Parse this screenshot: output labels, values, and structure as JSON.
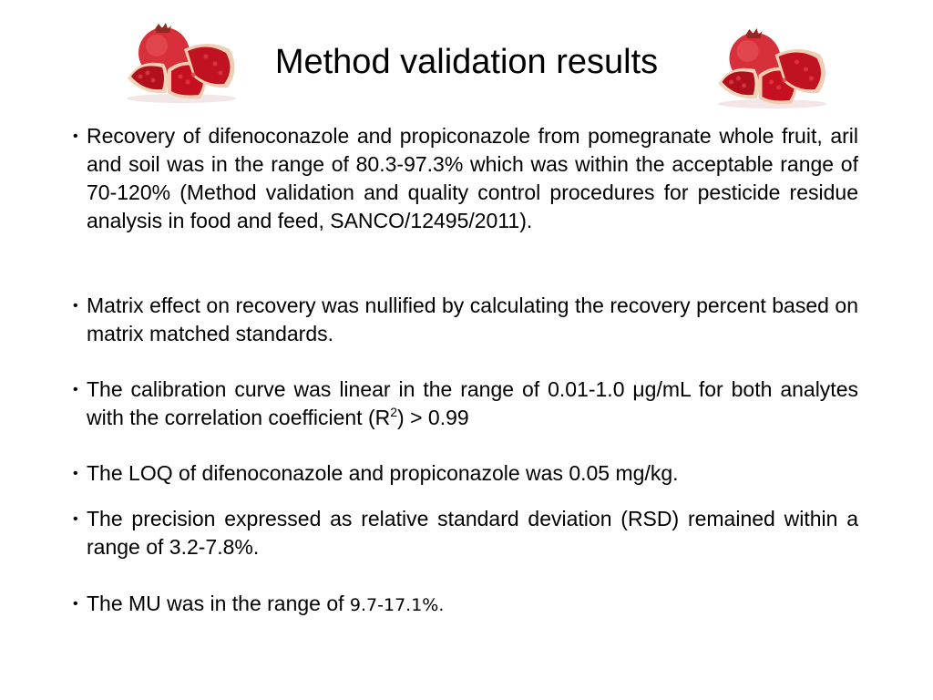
{
  "slide": {
    "title": "Method validation results",
    "images": {
      "left": "pomegranate-photo",
      "right": "pomegranate-photo"
    },
    "bullets": [
      {
        "marker": "•",
        "text": "Recovery of difenoconazole and propiconazole from pomegranate whole fruit, aril and soil was in the range of 80.3-97.3% which was within the acceptable range of 70-120% (Method validation and quality control procedures for pesticide residue analysis in food and feed, SANCO/12495/2011)."
      },
      {
        "marker": "•",
        "text": "Matrix effect on recovery was nullified by calculating the recovery percent based on matrix matched standards."
      },
      {
        "marker": "•",
        "text_before": "The calibration curve was linear in the range of 0.01-1.0 μg/mL for both analytes with the correlation coefficient (R",
        "superscript": "2",
        "text_after": ") > 0.99"
      },
      {
        "marker": "•",
        "text": "The LOQ of difenoconazole and propiconazole was 0.05 mg/kg."
      },
      {
        "marker": "•",
        "text": "The precision expressed as relative standard deviation (RSD) remained within a range of 3.2-7.8%."
      },
      {
        "marker": "•",
        "text_before": "The MU was in the range of ",
        "text_alt_font": "9.7-17.1%."
      }
    ]
  }
}
